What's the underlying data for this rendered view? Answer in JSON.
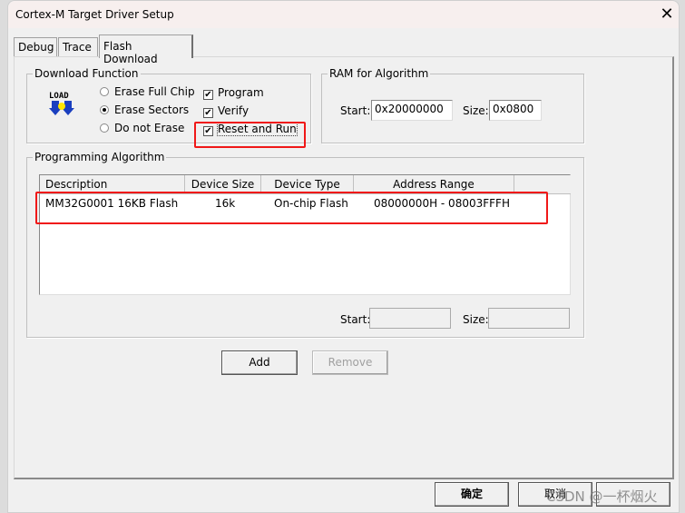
{
  "window": {
    "title": "Cortex-M Target Driver Setup"
  },
  "tabs": [
    {
      "label": "Debug"
    },
    {
      "label": "Trace"
    },
    {
      "label": "Flash Download",
      "active": true
    }
  ],
  "download_function": {
    "title": "Download Function",
    "icon": "load-icon",
    "icon_text": "LOAD",
    "erase_options": [
      {
        "label": "Erase Full Chip",
        "selected": false
      },
      {
        "label": "Erase Sectors",
        "selected": true
      },
      {
        "label": "Do not Erase",
        "selected": false
      }
    ],
    "checks": [
      {
        "label": "Program",
        "checked": true
      },
      {
        "label": "Verify",
        "checked": true
      },
      {
        "label": "Reset and Run",
        "checked": true
      }
    ]
  },
  "ram": {
    "title": "RAM for Algorithm",
    "start_label": "Start:",
    "start_value": "0x20000000",
    "size_label": "Size:",
    "size_value": "0x0800"
  },
  "algorithm": {
    "title": "Programming Algorithm",
    "columns": [
      "Description",
      "Device Size",
      "Device Type",
      "Address Range"
    ],
    "rows": [
      {
        "description": "MM32G0001 16KB Flash",
        "size": "16k",
        "type": "On-chip Flash",
        "range": "08000000H - 08003FFFH"
      }
    ],
    "start_label": "Start:",
    "start_value": "",
    "size_label": "Size:",
    "size_value": ""
  },
  "buttons": {
    "add": "Add",
    "remove": "Remove",
    "ok": "确定",
    "cancel": "取消"
  },
  "watermark": "CSDN @一杯烟火",
  "highlight_color": "#f01818"
}
